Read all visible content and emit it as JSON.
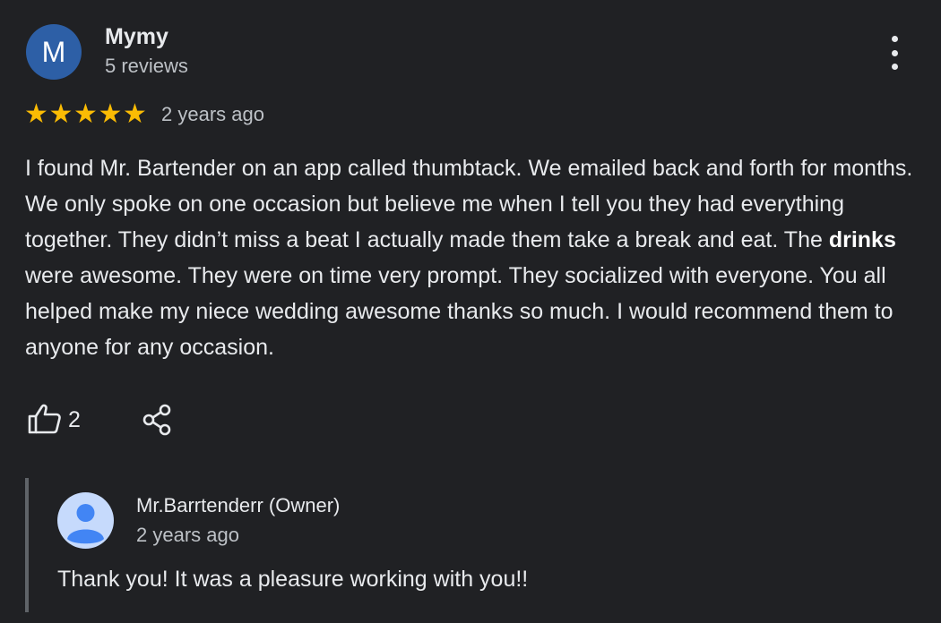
{
  "review": {
    "avatar_letter": "M",
    "author": "Mymy",
    "author_meta": "5 reviews",
    "rating": 5,
    "stars": [
      "★",
      "★",
      "★",
      "★",
      "★"
    ],
    "time": "2 years ago",
    "text_before_bold": "I found Mr. Bartender on an app called thumbtack. We emailed back and forth for months. We only spoke on one occasion but believe me when I tell you they had everything together. They didn’t miss a beat I actually made them take a break and eat. The ",
    "text_bold": "drinks",
    "text_after_bold": " were awesome. They were on time very prompt. They socialized with everyone. You all helped make my niece wedding awesome thanks so much. I would recommend them to anyone for any occasion.",
    "like_count": "2",
    "icons": {
      "more": "more-vert-icon",
      "like": "thumb-up-icon",
      "share": "share-icon"
    }
  },
  "owner_reply": {
    "name": "Mr.Barrtenderr (Owner)",
    "time": "2 years ago",
    "text": "Thank you! It was a pleasure working with you!!"
  },
  "colors": {
    "background": "#202124",
    "star": "#fbbc04",
    "avatar": "#2d5fa6",
    "owner_avatar": "#c6dafc"
  }
}
